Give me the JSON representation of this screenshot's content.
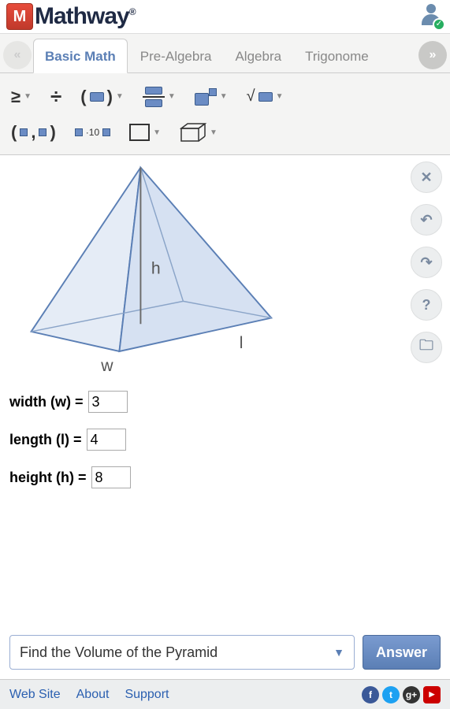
{
  "header": {
    "logo_text": "Mathway",
    "logo_mark": "M"
  },
  "tabs": {
    "items": [
      "Basic Math",
      "Pre-Algebra",
      "Algebra",
      "Trigonome"
    ],
    "active_index": 0
  },
  "figure": {
    "labels": {
      "height": "h",
      "length": "l",
      "width": "w"
    }
  },
  "inputs": {
    "width": {
      "label": "width (w) =",
      "value": "3"
    },
    "length": {
      "label": "length (l) =",
      "value": "4"
    },
    "height": {
      "label": "height (h) =",
      "value": "8"
    }
  },
  "action": {
    "dropdown_label": "Find the Volume of the Pyramid",
    "answer_label": "Answer"
  },
  "footer": {
    "links": [
      "Web Site",
      "About",
      "Support"
    ]
  },
  "side": {
    "close": "✕",
    "undo": "↶",
    "redo": "↷",
    "help": "?",
    "folder": "🗀"
  }
}
